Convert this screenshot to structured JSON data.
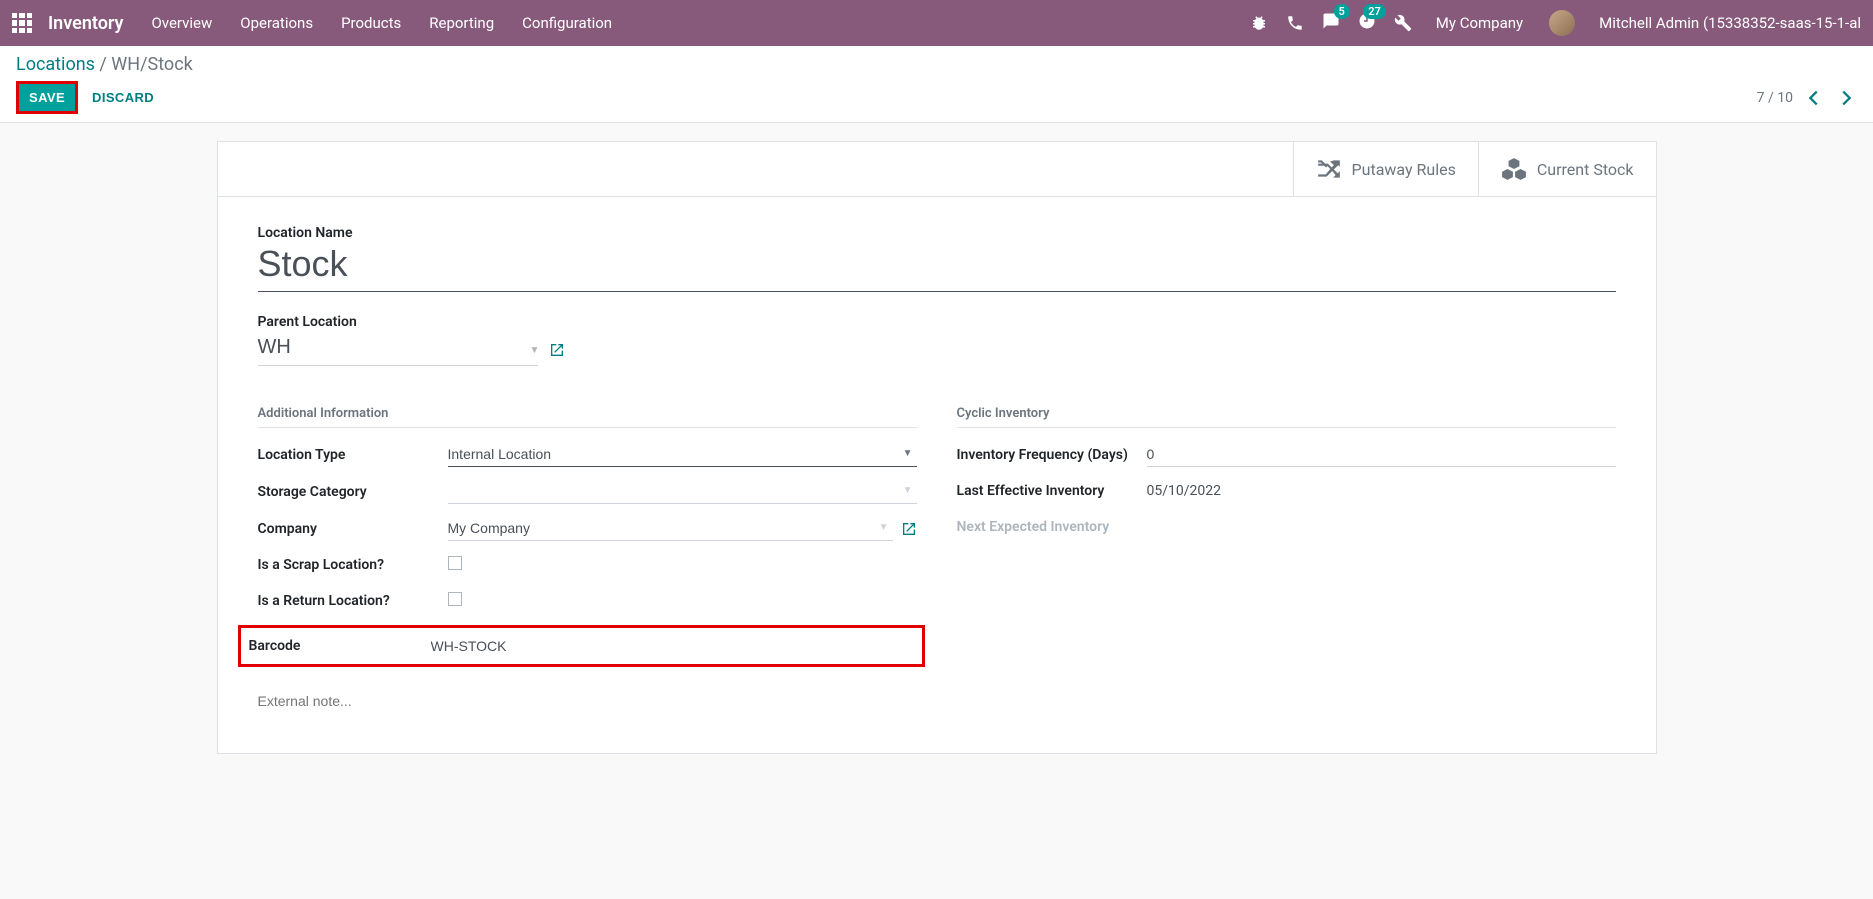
{
  "nav": {
    "brand": "Inventory",
    "menu": [
      "Overview",
      "Operations",
      "Products",
      "Reporting",
      "Configuration"
    ],
    "msg_badge": "5",
    "activity_badge": "27",
    "company": "My Company",
    "user": "Mitchell Admin (15338352-saas-15-1-al"
  },
  "breadcrumb": {
    "root": "Locations",
    "sep": " / ",
    "current": "WH/Stock"
  },
  "buttons": {
    "save": "SAVE",
    "discard": "DISCARD"
  },
  "pager": {
    "text": "7 / 10"
  },
  "stat": {
    "putaway": "Putaway Rules",
    "stock": "Current Stock"
  },
  "form": {
    "name_label": "Location Name",
    "name_value": "Stock",
    "parent_label": "Parent Location",
    "parent_value": "WH",
    "section_left": "Additional Information",
    "loc_type_label": "Location Type",
    "loc_type_value": "Internal Location",
    "storage_label": "Storage Category",
    "storage_value": "",
    "company_label": "Company",
    "company_value": "My Company",
    "scrap_label": "Is a Scrap Location?",
    "return_label": "Is a Return Location?",
    "barcode_label": "Barcode",
    "barcode_value": "WH-STOCK",
    "section_right": "Cyclic Inventory",
    "freq_label": "Inventory Frequency (Days)",
    "freq_value": "0",
    "last_label": "Last Effective Inventory",
    "last_value": "05/10/2022",
    "next_label": "Next Expected Inventory",
    "next_value": "",
    "note_placeholder": "External note..."
  }
}
